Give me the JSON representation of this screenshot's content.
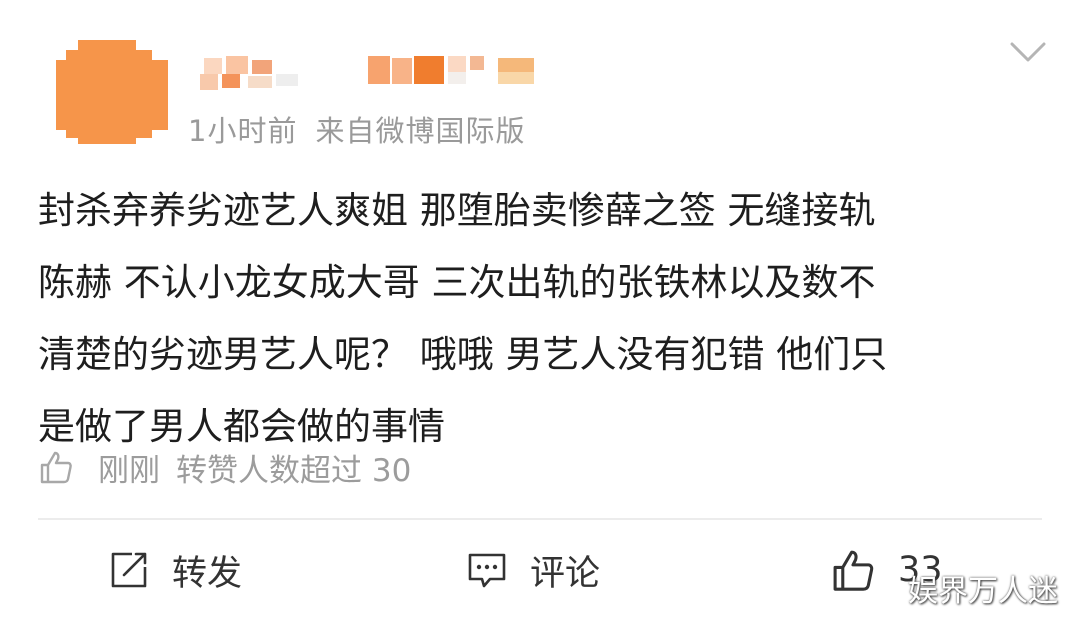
{
  "post": {
    "meta": {
      "time": "1小时前",
      "source": "来自微博国际版"
    },
    "content": "封杀弃养劣迹艺人爽姐 那堕胎卖惨薛之签 无缝接轨\n陈赫 不认小龙女成大哥 三次出轨的张铁林以及数不\n清楚的劣迹男艺人呢？ 哦哦 男艺人没有犯错 他们只\n是做了男人都会做的事情",
    "repost_info": {
      "time": "刚刚",
      "text": "转赞人数超过 30"
    }
  },
  "actions": {
    "repost_label": "转发",
    "comment_label": "评论",
    "like_count": "33"
  },
  "watermark": "娱界万人迷",
  "colors": {
    "avatar": "#f6954a",
    "secondary_text": "#9a9a9a",
    "body_text": "#1e1e1e"
  },
  "icons": [
    "chevron-down-icon",
    "thumbs-up-icon",
    "repost-icon",
    "comment-icon"
  ]
}
